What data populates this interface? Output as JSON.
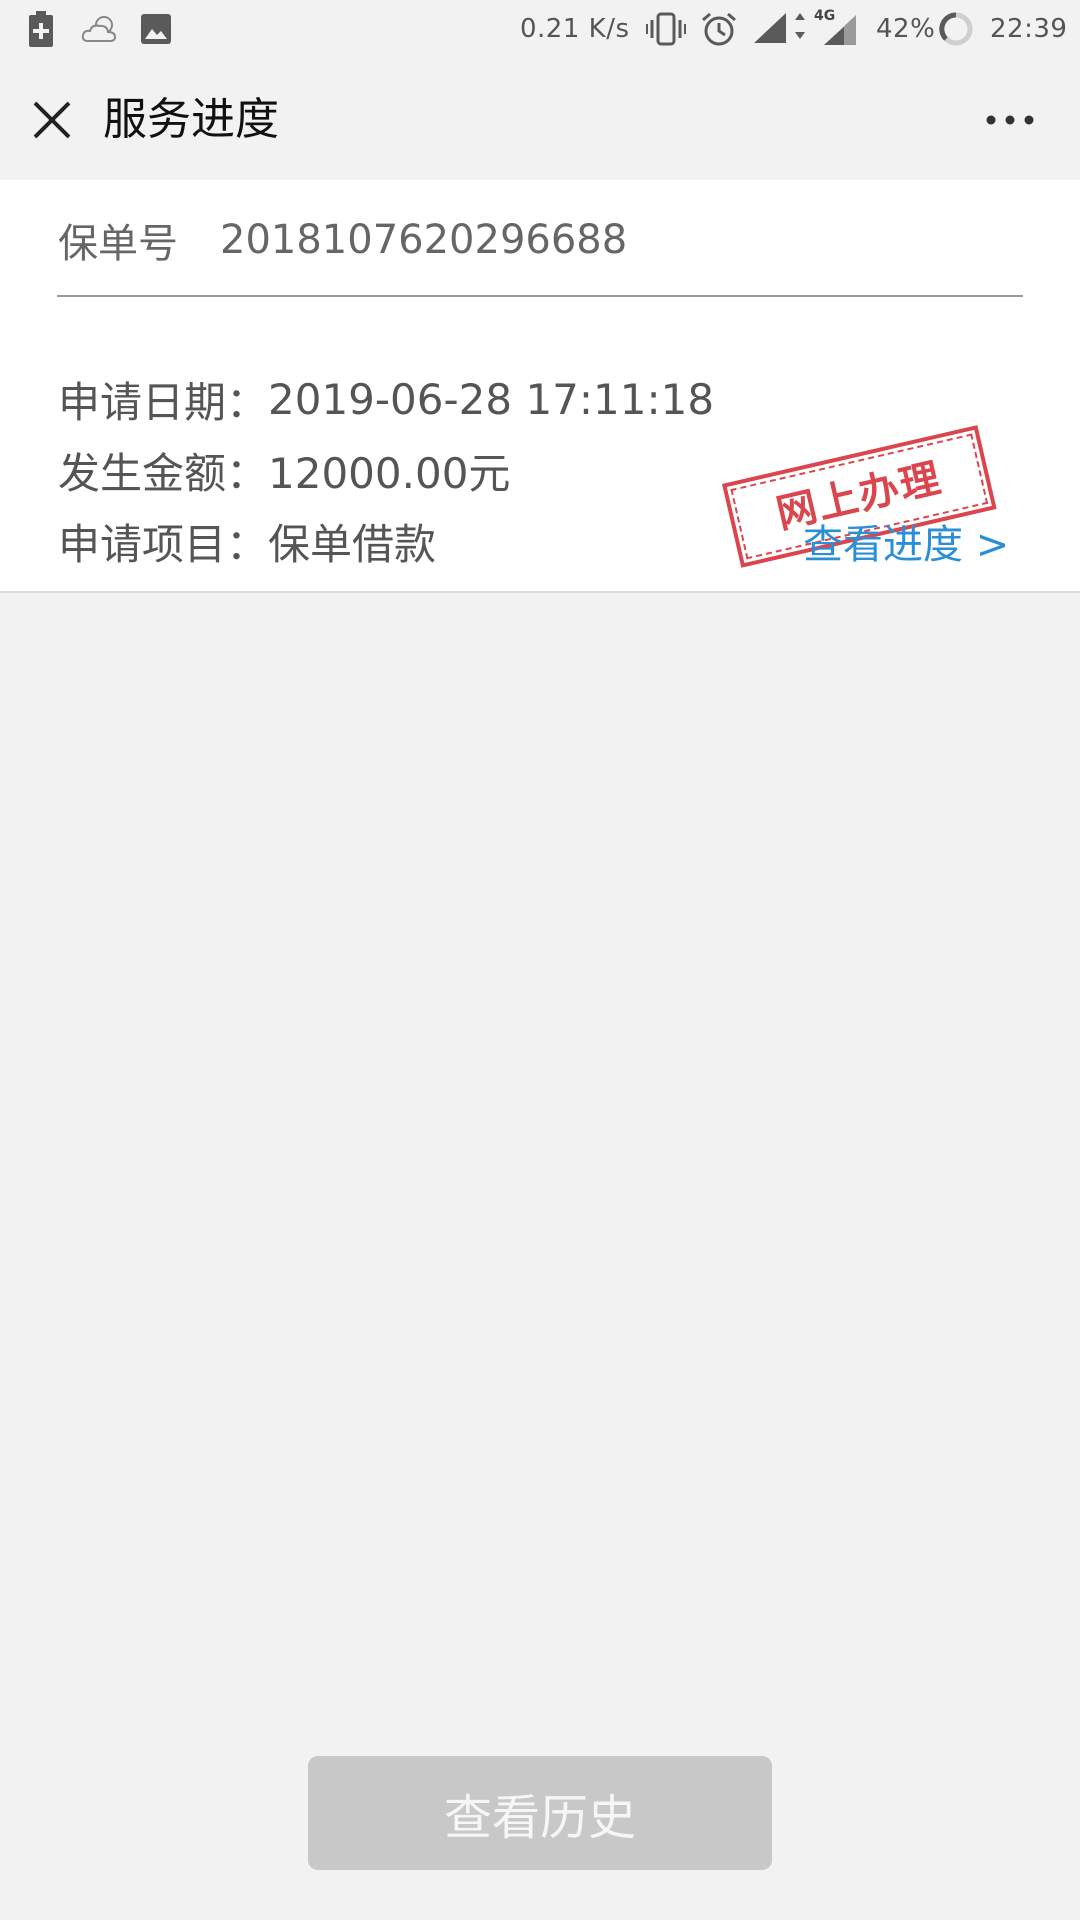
{
  "status_bar": {
    "network_speed": "0.21 K/s",
    "network_type": "4G",
    "battery_percent": "42%",
    "time": "22:39",
    "icons": [
      "battery-saver-icon",
      "weather-cloud-icon",
      "gallery-icon",
      "vibrate-icon",
      "alarm-icon",
      "signal-icon",
      "data-arrows-icon",
      "signal-4g-icon",
      "battery-ring-icon"
    ]
  },
  "header": {
    "title": "服务进度",
    "close_icon": "close-icon",
    "more_icon": "more-dots-icon"
  },
  "card": {
    "policy_label": "保单号",
    "policy_number": "2018107620296688",
    "date_label": "申请日期：",
    "date_value": "2019-06-28 17:11:18",
    "amount_label": "发生金额：",
    "amount_value": "12000.00元",
    "item_label": "申请项目：",
    "item_value": "保单借款",
    "view_progress": "查看进度 >",
    "stamp_text": "网上办理",
    "colors": {
      "stamp": "#d9363e",
      "link": "#2a8fd6"
    }
  },
  "footer": {
    "history_button": "查看历史"
  }
}
